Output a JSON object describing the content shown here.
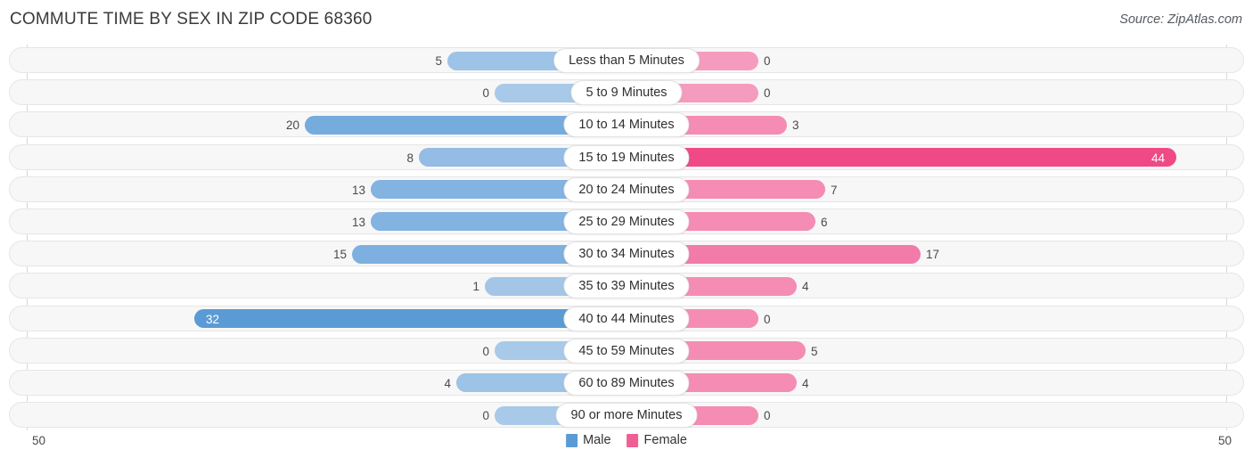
{
  "header": {
    "title": "COMMUTE TIME BY SEX IN ZIP CODE 68360",
    "source": "Source: ZipAtlas.com"
  },
  "legend": {
    "male_label": "Male",
    "female_label": "Female",
    "male_color": "#5b9bd5",
    "female_color": "#ef5f94"
  },
  "axis": {
    "left_label": "50",
    "right_label": "50",
    "max": 50
  },
  "chart_data": {
    "type": "bar",
    "subtype": "diverging-bar",
    "title": "COMMUTE TIME BY SEX IN ZIP CODE 68360",
    "xlabel": "",
    "ylabel": "",
    "xlim": [
      50,
      50
    ],
    "grid": false,
    "legend_position": "bottom-center",
    "categories": [
      "Less than 5 Minutes",
      "5 to 9 Minutes",
      "10 to 14 Minutes",
      "15 to 19 Minutes",
      "20 to 24 Minutes",
      "25 to 29 Minutes",
      "30 to 34 Minutes",
      "35 to 39 Minutes",
      "40 to 44 Minutes",
      "45 to 59 Minutes",
      "60 to 89 Minutes",
      "90 or more Minutes"
    ],
    "series": [
      {
        "name": "Male",
        "color": "#5b9bd5",
        "values": [
          5,
          0,
          20,
          8,
          13,
          13,
          15,
          1,
          32,
          0,
          4,
          0
        ]
      },
      {
        "name": "Female",
        "color": "#ef5f94",
        "values": [
          0,
          0,
          3,
          44,
          7,
          6,
          17,
          4,
          0,
          5,
          4,
          0
        ]
      }
    ]
  },
  "rows": [
    {
      "label": "Less than 5 Minutes",
      "male": "5",
      "female": "0",
      "male_w": 201,
      "female_w": 148,
      "male_fill": "#9dc3e6",
      "female_fill": "#f59cbe",
      "male_inside": false,
      "female_inside": false
    },
    {
      "label": "5 to 9 Minutes",
      "male": "0",
      "female": "0",
      "male_w": 148,
      "female_w": 148,
      "male_fill": "#a8c9e8",
      "female_fill": "#f59cbe",
      "male_inside": false,
      "female_inside": false
    },
    {
      "label": "10 to 14 Minutes",
      "male": "20",
      "female": "3",
      "male_w": 361,
      "female_w": 180,
      "male_fill": "#76abde",
      "female_fill": "#f58cb4",
      "male_inside": false,
      "female_inside": false
    },
    {
      "label": "15 to 19 Minutes",
      "male": "8",
      "female": "44",
      "male_w": 233,
      "female_w": 617,
      "male_fill": "#94bce4",
      "female_fill": "#ef4a85",
      "male_inside": false,
      "female_inside": true
    },
    {
      "label": "20 to 24 Minutes",
      "male": "13",
      "female": "7",
      "male_w": 287,
      "female_w": 223,
      "male_fill": "#82b3e1",
      "female_fill": "#f58cb4",
      "male_inside": false,
      "female_inside": false
    },
    {
      "label": "25 to 29 Minutes",
      "male": "13",
      "female": "6",
      "male_w": 287,
      "female_w": 212,
      "male_fill": "#82b3e1",
      "female_fill": "#f58cb4",
      "male_inside": false,
      "female_inside": false
    },
    {
      "label": "30 to 34 Minutes",
      "male": "15",
      "female": "17",
      "male_w": 308,
      "female_w": 330,
      "male_fill": "#7db0e0",
      "female_fill": "#f27ba9",
      "male_inside": false,
      "female_inside": false
    },
    {
      "label": "35 to 39 Minutes",
      "male": "1",
      "female": "4",
      "male_w": 159,
      "female_w": 191,
      "male_fill": "#a3c6e7",
      "female_fill": "#f58cb4",
      "male_inside": false,
      "female_inside": false
    },
    {
      "label": "40 to 44 Minutes",
      "male": "32",
      "female": "0",
      "male_w": 485,
      "female_w": 148,
      "male_fill": "#5b9bd5",
      "female_fill": "#f58cb4",
      "male_inside": true,
      "female_inside": false
    },
    {
      "label": "45 to 59 Minutes",
      "male": "0",
      "female": "5",
      "male_w": 148,
      "female_w": 201,
      "male_fill": "#a8c9e8",
      "female_fill": "#f58cb4",
      "male_inside": false,
      "female_inside": false
    },
    {
      "label": "60 to 89 Minutes",
      "male": "4",
      "female": "4",
      "male_w": 191,
      "female_w": 191,
      "male_fill": "#9dc3e6",
      "female_fill": "#f58cb4",
      "male_inside": false,
      "female_inside": false
    },
    {
      "label": "90 or more Minutes",
      "male": "0",
      "female": "0",
      "male_w": 148,
      "female_w": 148,
      "male_fill": "#a8c9e8",
      "female_fill": "#f58cb4",
      "male_inside": false,
      "female_inside": false
    }
  ]
}
